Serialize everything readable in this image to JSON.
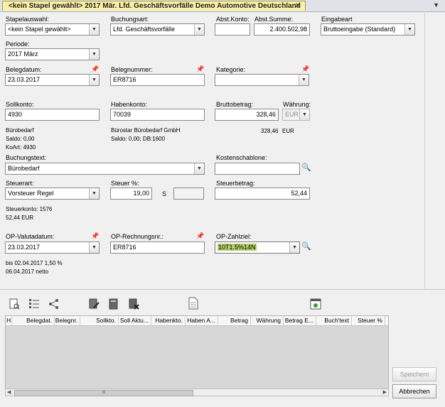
{
  "tab": {
    "title": "<kein Stapel gewählt> 2017 Mär. Lfd. Geschäftsvorfälle Demo Automotive Deutschland",
    "close": "✕",
    "menu": "▼"
  },
  "form": {
    "stapel": {
      "label": "Stapelauswahl:",
      "value": "<kein Stapel gewählt>"
    },
    "buchungsart": {
      "label": "Buchungsart:",
      "value": "Lfd. Geschäftsvorfälle"
    },
    "abstkonto": {
      "label": "Abst.Konto:",
      "value": ""
    },
    "abstsumme": {
      "label": "Abst.Summe:",
      "value": "2.400.502,98"
    },
    "eingabeart": {
      "label": "Eingabeart",
      "value": "Bruttoeingabe (Standard)"
    },
    "periode": {
      "label": "Periode:",
      "value": "2017  März"
    },
    "belegdatum": {
      "label": "Belegdatum:",
      "value": "23.03.2017"
    },
    "belegnummer": {
      "label": "Belegnummer:",
      "value": "ER8716"
    },
    "kategorie": {
      "label": "Kategorie:",
      "value": ""
    },
    "sollkonto": {
      "label": "Sollkonto:",
      "value": "4930",
      "info1": "Bürobedarf",
      "info2": "Saldo: 0,00",
      "info3": "KoArt: 4930"
    },
    "habenkonto": {
      "label": "Habenkonto:",
      "value": "70039",
      "info1": "Bürostar Bürobedarf GmbH",
      "info2": "Saldo: 0,00; DB:1600"
    },
    "brutto": {
      "label": "Bruttobetrag:",
      "value": "328,46",
      "info_value": "328,46",
      "info_currency": "EUR"
    },
    "waehrung": {
      "label": "Währung:",
      "value": "EUR"
    },
    "buchungstext": {
      "label": "Buchungstext:",
      "value": "Bürobedarf"
    },
    "kostenschablone": {
      "label": "Kostenschablone:",
      "value": ""
    },
    "steuerart": {
      "label": "Steuerart:",
      "value": "Vorsteuer Regel",
      "info1": "Steuerkonto: 1576",
      "info2": "52,44 EUR"
    },
    "steuerproz": {
      "label": "Steuer %:",
      "value": "19,00",
      "s_label": "S",
      "s_value": ""
    },
    "steuerbetrag": {
      "label": "Steuerbetrag:",
      "value": "52,44"
    },
    "opvaluta": {
      "label": "OP-Valutadatum:",
      "value": "23.03.2017",
      "info1": "bis 02.04.2017 1,50 %",
      "info2": "06.04.2017 netto"
    },
    "oprechnung": {
      "label": "OP-Rechnungsnr.:",
      "value": "ER8716"
    },
    "opzahlziel": {
      "label": "OP-Zahlziel:",
      "value": "10T1.5%14N"
    }
  },
  "grid": {
    "columns": [
      "H",
      "Belegdat.",
      "Belegnr.",
      "Sollkto.",
      "Soll Aktu...",
      "Habenkto.",
      "Haben A...",
      "Betrag",
      "Währung",
      "Betrag E...",
      "Buch'text",
      "Steuer %"
    ],
    "scroll_handle": "III"
  },
  "buttons": {
    "speichern": "Speichern",
    "abbrechen": "Abbrechen"
  },
  "glyphs": {
    "dropdown": "▼",
    "pin": "📌",
    "search": "🔍",
    "arrow_left": "◀",
    "arrow_right": "▶"
  }
}
